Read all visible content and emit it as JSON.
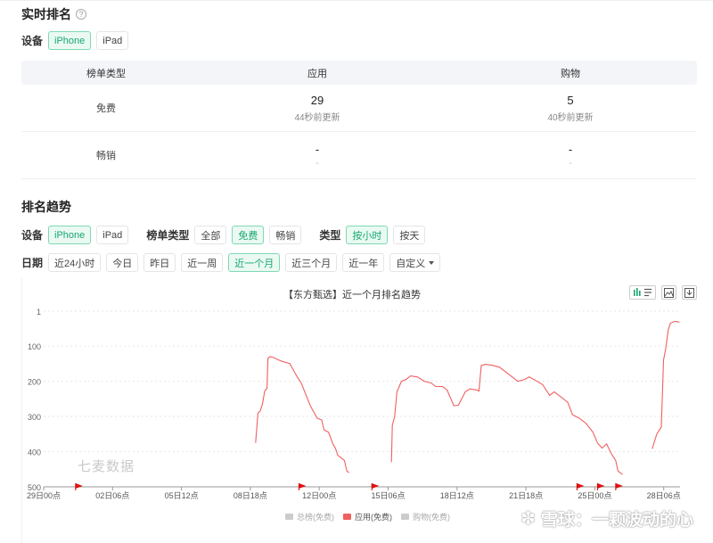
{
  "realtime": {
    "title": "实时排名",
    "help_icon": "?",
    "device_label": "设备",
    "devices": [
      "iPhone",
      "iPad"
    ],
    "table": {
      "headers": [
        "榜单类型",
        "应用",
        "购物"
      ],
      "rows": [
        {
          "type": "免费",
          "app_rank": "29",
          "app_updated": "44秒前更新",
          "shop_rank": "5",
          "shop_updated": "40秒前更新"
        },
        {
          "type": "畅销",
          "app_rank": "-",
          "app_updated": "-",
          "shop_rank": "-",
          "shop_updated": "-"
        }
      ]
    }
  },
  "trend": {
    "title": "排名趋势",
    "device_label": "设备",
    "devices": [
      "iPhone",
      "iPad"
    ],
    "list_label": "榜单类型",
    "lists": [
      "全部",
      "免费",
      "畅销"
    ],
    "kind_label": "类型",
    "kinds": [
      "按小时",
      "按天"
    ],
    "date_label": "日期",
    "dates": [
      "近24小时",
      "今日",
      "昨日",
      "近一周",
      "近一个月",
      "近三个月",
      "近一年",
      "自定义"
    ]
  },
  "chart_data": {
    "type": "line",
    "title": "【东方甄选】近一个月排名趋势",
    "y_ticks": [
      "1",
      "100",
      "200",
      "300",
      "400",
      "500"
    ],
    "ylim": [
      500,
      1
    ],
    "x_ticks": [
      "29日00点",
      "02日06点",
      "05日12点",
      "08日18点",
      "12日00点",
      "15日06点",
      "18日12点",
      "21日18点",
      "25日00点",
      "28日06点"
    ],
    "series": [
      {
        "name": "总榜(免费)",
        "color": "#cccccc",
        "values": []
      },
      {
        "name": "应用(免费)",
        "color": "#f06060",
        "segments": [
          [
            [
              0.465,
              375
            ],
            [
              0.47,
              290
            ],
            [
              0.475,
              285
            ],
            [
              0.48,
              265
            ],
            [
              0.485,
              228
            ],
            [
              0.49,
              220
            ],
            [
              0.492,
              135
            ],
            [
              0.497,
              130
            ],
            [
              0.505,
              133
            ],
            [
              0.52,
              142
            ],
            [
              0.54,
              150
            ],
            [
              0.555,
              185
            ],
            [
              0.565,
              205
            ],
            [
              0.585,
              270
            ],
            [
              0.6,
              305
            ],
            [
              0.61,
              310
            ],
            [
              0.615,
              338
            ],
            [
              0.625,
              345
            ],
            [
              0.635,
              380
            ],
            [
              0.64,
              390
            ],
            [
              0.645,
              410
            ],
            [
              0.66,
              425
            ],
            [
              0.665,
              455
            ],
            [
              0.67,
              460
            ]
          ],
          [
            [
              0.763,
              430
            ],
            [
              0.765,
              325
            ],
            [
              0.77,
              300
            ],
            [
              0.775,
              230
            ],
            [
              0.785,
              200
            ],
            [
              0.795,
              195
            ],
            [
              0.805,
              185
            ],
            [
              0.82,
              188
            ],
            [
              0.835,
              200
            ],
            [
              0.85,
              205
            ],
            [
              0.86,
              215
            ],
            [
              0.875,
              215
            ],
            [
              0.885,
              225
            ],
            [
              0.9,
              270
            ],
            [
              0.91,
              268
            ],
            [
              0.925,
              230
            ],
            [
              0.935,
              222
            ],
            [
              0.95,
              225
            ],
            [
              0.955,
              228
            ],
            [
              0.96,
              155
            ],
            [
              0.97,
              152
            ],
            [
              0.985,
              155
            ],
            [
              1.0,
              160
            ],
            [
              1.015,
              175
            ],
            [
              1.03,
              190
            ],
            [
              1.04,
              200
            ],
            [
              1.055,
              195
            ],
            [
              1.065,
              188
            ],
            [
              1.08,
              198
            ],
            [
              1.095,
              210
            ],
            [
              1.11,
              240
            ],
            [
              1.12,
              230
            ],
            [
              1.135,
              245
            ],
            [
              1.15,
              260
            ],
            [
              1.16,
              295
            ],
            [
              1.175,
              305
            ],
            [
              1.19,
              320
            ],
            [
              1.205,
              345
            ],
            [
              1.215,
              375
            ],
            [
              1.225,
              390
            ],
            [
              1.235,
              378
            ],
            [
              1.245,
              405
            ],
            [
              1.255,
              425
            ],
            [
              1.26,
              455
            ],
            [
              1.27,
              465
            ]
          ],
          [
            [
              1.335,
              392
            ],
            [
              1.345,
              350
            ],
            [
              1.355,
              330
            ],
            [
              1.36,
              140
            ],
            [
              1.365,
              105
            ],
            [
              1.37,
              55
            ],
            [
              1.375,
              35
            ],
            [
              1.385,
              30
            ],
            [
              1.395,
              32
            ]
          ]
        ]
      },
      {
        "name": "购物(免费)",
        "color": "#cccccc",
        "values": []
      }
    ],
    "flags_at": [
      0.07,
      0.56,
      0.72,
      1.17,
      1.215,
      1.255
    ],
    "grid": "dashed-horizontal",
    "legend_position": "bottom-center"
  },
  "watermark": "七麦数据",
  "footer_watermark": "雪球：一颗波动的心"
}
